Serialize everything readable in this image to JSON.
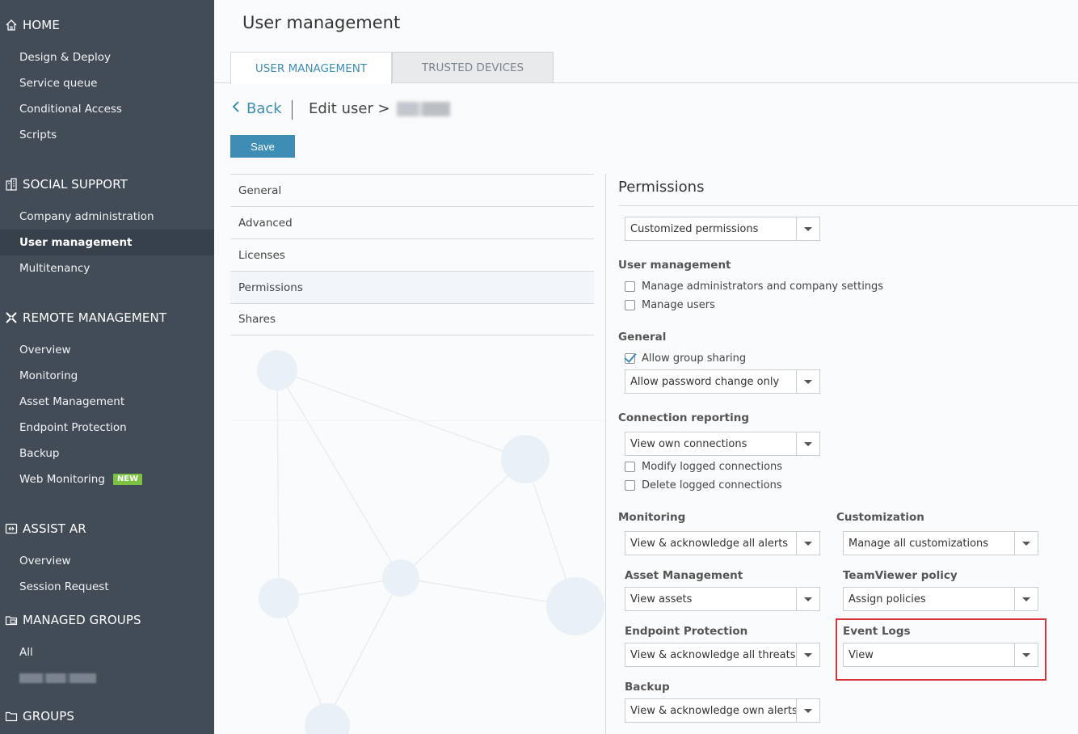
{
  "sidebar": {
    "sections": [
      {
        "title": "HOME",
        "icon": "home-icon",
        "items": [
          "Design & Deploy",
          "Service queue",
          "Conditional Access",
          "Scripts"
        ]
      },
      {
        "title": "SOCIAL SUPPORT",
        "icon": "building-icon",
        "items": [
          "Company administration",
          "User management",
          "Multitenancy"
        ]
      },
      {
        "title": "REMOTE MANAGEMENT",
        "icon": "cross-arrows-icon",
        "items": [
          "Overview",
          "Monitoring",
          "Asset Management",
          "Endpoint Protection",
          "Backup",
          "Web Monitoring"
        ]
      },
      {
        "title": "ASSIST AR",
        "icon": "assist-ar-icon",
        "items": [
          "Overview",
          "Session Request"
        ]
      },
      {
        "title": "MANAGED GROUPS",
        "icon": "managed-groups-icon",
        "items": [
          "All"
        ]
      },
      {
        "title": "GROUPS",
        "icon": "folder-icon",
        "items": []
      }
    ],
    "active_item": "User management",
    "new_badge": "NEW"
  },
  "main": {
    "title": "User management",
    "tabs": [
      "USER MANAGEMENT",
      "TRUSTED DEVICES"
    ],
    "back_label": "Back",
    "edit_user_label": "Edit user >",
    "save_label": "Save",
    "left_menu": [
      "General",
      "Advanced",
      "Licenses",
      "Permissions",
      "Shares"
    ],
    "active_left_menu": "Permissions"
  },
  "permissions": {
    "title": "Permissions",
    "profile_select": "Customized permissions",
    "user_management": {
      "label": "User management",
      "options": [
        {
          "label": "Manage administrators and company settings",
          "checked": false
        },
        {
          "label": "Manage users",
          "checked": false
        }
      ]
    },
    "general": {
      "label": "General",
      "allow_group_sharing": {
        "label": "Allow group sharing",
        "checked": true
      },
      "password_select": "Allow password change only"
    },
    "connection_reporting": {
      "label": "Connection reporting",
      "select": "View own connections",
      "options": [
        {
          "label": "Modify logged connections",
          "checked": false
        },
        {
          "label": "Delete logged connections",
          "checked": false
        }
      ]
    },
    "monitoring": {
      "label": "Monitoring",
      "select": "View & acknowledge all alerts"
    },
    "customization": {
      "label": "Customization",
      "select": "Manage all customizations"
    },
    "asset_management": {
      "label": "Asset Management",
      "select": "View assets"
    },
    "teamviewer_policy": {
      "label": "TeamViewer policy",
      "select": "Assign policies"
    },
    "endpoint_protection": {
      "label": "Endpoint Protection",
      "select": "View & acknowledge all threats"
    },
    "event_logs": {
      "label": "Event Logs",
      "select": "View"
    },
    "backup": {
      "label": "Backup",
      "select": "View & acknowledge own alerts"
    }
  },
  "colors": {
    "accent": "#3d8db5",
    "sidebar": "#414c57",
    "highlight": "#d9333c",
    "new_badge": "#7cc242"
  }
}
